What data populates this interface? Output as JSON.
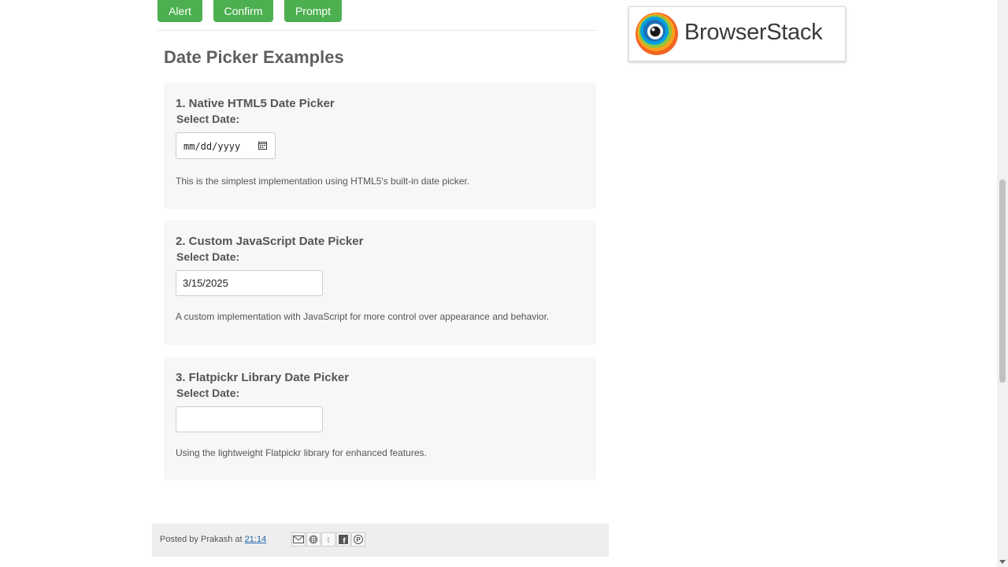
{
  "buttons": {
    "alert": "Alert",
    "confirm": "Confirm",
    "prompt": "Prompt"
  },
  "section_title": "Date Picker Examples",
  "pickers": [
    {
      "title": "1. Native HTML5 Date Picker",
      "label": "Select Date:",
      "placeholder": "mm/dd/yyyy",
      "description": "This is the simplest implementation using HTML5's built-in date picker."
    },
    {
      "title": "2. Custom JavaScript Date Picker",
      "label": "Select Date:",
      "value": "3/15/2025",
      "description": "A custom implementation with JavaScript for more control over appearance and behavior."
    },
    {
      "title": "3. Flatpickr Library Date Picker",
      "label": "Select Date:",
      "value": "",
      "description": "Using the lightweight Flatpickr library for enhanced features."
    }
  ],
  "ad": {
    "brand": "BrowserStack"
  },
  "footer": {
    "posted_by_prefix": "Posted by",
    "author": "Prakash",
    "at": "at",
    "time": "21:14",
    "share_icons": [
      "email-icon",
      "blogger-icon",
      "twitter-icon",
      "facebook-icon",
      "pinterest-icon"
    ]
  },
  "colors": {
    "button_bg": "#4caf50",
    "card_bg": "#f7f7f7",
    "footer_bg": "#eeeeee",
    "link": "#2266aa"
  }
}
